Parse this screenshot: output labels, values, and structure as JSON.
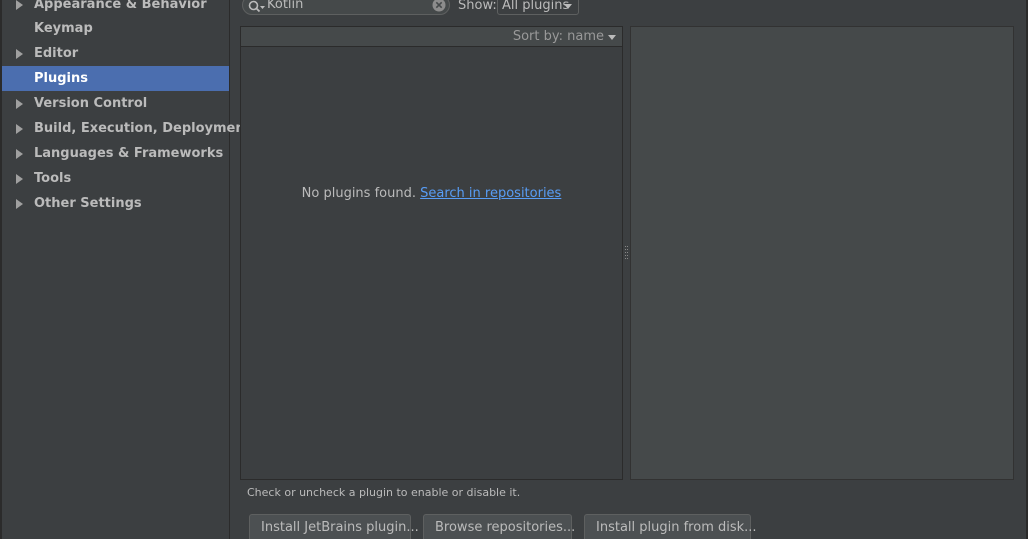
{
  "sidebar": {
    "items": [
      {
        "label": "Appearance & Behavior",
        "expandable": true,
        "selected": false
      },
      {
        "label": "Keymap",
        "expandable": false,
        "selected": false
      },
      {
        "label": "Editor",
        "expandable": true,
        "selected": false
      },
      {
        "label": "Plugins",
        "expandable": false,
        "selected": true
      },
      {
        "label": "Version Control",
        "expandable": true,
        "selected": false
      },
      {
        "label": "Build, Execution, Deployment",
        "expandable": true,
        "selected": false
      },
      {
        "label": "Languages & Frameworks",
        "expandable": true,
        "selected": false
      },
      {
        "label": "Tools",
        "expandable": true,
        "selected": false
      },
      {
        "label": "Other Settings",
        "expandable": true,
        "selected": false
      }
    ]
  },
  "toolbar": {
    "search_value": "Kotlin",
    "search_icon": "search-icon",
    "clear_icon": "clear-icon",
    "show_label": "Show:",
    "show_selected": "All plugins"
  },
  "plugin_list": {
    "sort_label": "Sort by: name",
    "empty_text": "No plugins found.",
    "empty_link": "Search in repositories"
  },
  "footer": {
    "hint": "Check or uncheck a plugin to enable or disable it.",
    "install_jetbrains": "Install JetBrains plugin...",
    "browse_repositories": "Browse repositories...",
    "install_from_disk": "Install plugin from disk..."
  },
  "colors": {
    "background": "#3c3f41",
    "selection": "#4b6eaf",
    "link": "#589df6",
    "details_panel": "#45494a"
  }
}
